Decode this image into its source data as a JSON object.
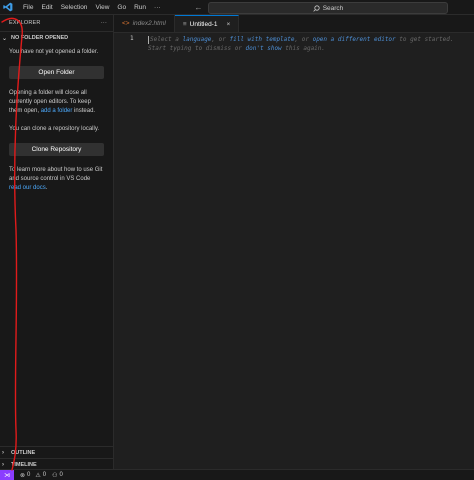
{
  "titlebar": {
    "menu": [
      "File",
      "Edit",
      "Selection",
      "View",
      "Go",
      "Run"
    ],
    "more": "···",
    "back_glyph": "←",
    "forward_glyph": "→",
    "search_label": "Search"
  },
  "sidebar": {
    "title": "EXPLORER",
    "more": "···",
    "section": "NO FOLDER OPENED",
    "msg1": "You have not yet opened a folder.",
    "open_folder_btn": "Open Folder",
    "msg2_pre": "Opening a folder will close all currently open editors. To keep them open, ",
    "msg2_link": "add a folder",
    "msg2_post": " instead.",
    "msg3": "You can clone a repository locally.",
    "clone_btn": "Clone Repository",
    "msg4_pre": "To learn more about how to use Git and source control in VS Code ",
    "msg4_link": "read our docs",
    "msg4_post": ".",
    "outline": "OUTLINE",
    "timeline": "TIMELINE"
  },
  "editor": {
    "tabs": [
      {
        "label": "index2.html",
        "icon": "html-icon",
        "active": false
      },
      {
        "label": "Untitled-1",
        "icon": "file-icon",
        "active": true
      }
    ],
    "close_glyph": "×",
    "line_number": "1",
    "hint": {
      "p1": "Select a ",
      "l1": "language",
      "p2": ", or ",
      "l2": "fill with template",
      "p3": ", or ",
      "l3": "open a different editor",
      "p4": " to get started.",
      "p5": "Start typing to dismiss or ",
      "l4": "don't show",
      "p6": " this again."
    }
  },
  "status": {
    "errors": "0",
    "warnings": "0",
    "ports": "0"
  },
  "colors": {
    "accent": "#0078d4",
    "remote": "#8b3dff",
    "annotation": "#e01b1b",
    "link": "#4daafc"
  }
}
